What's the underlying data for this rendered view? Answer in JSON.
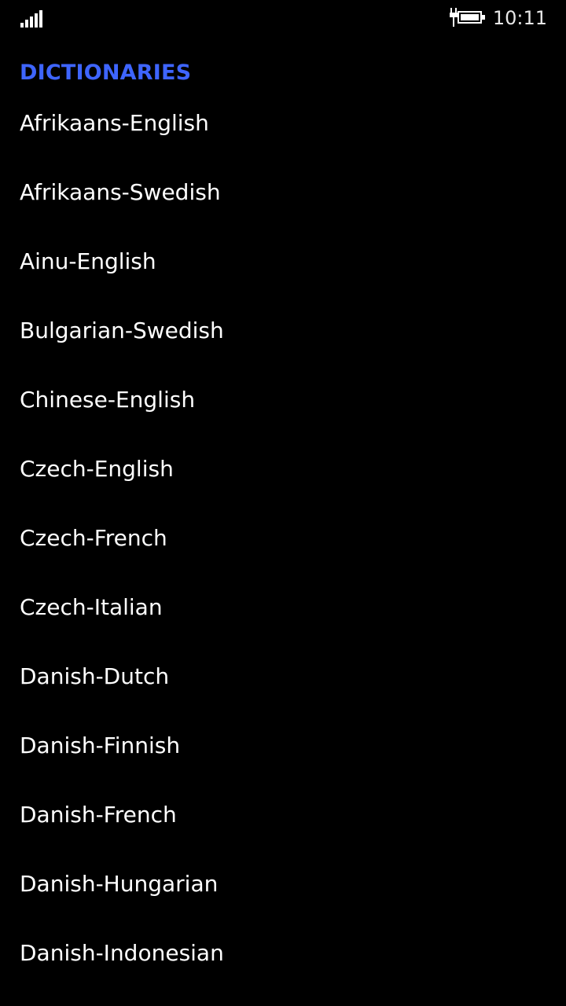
{
  "status_bar": {
    "signal_icon": "signal-strength-icon",
    "battery_icon": "battery-charging-icon",
    "time": "10:11"
  },
  "colors": {
    "background": "#000000",
    "accent": "#3e65ff",
    "text": "#ffffff"
  },
  "header": {
    "title": "DICTIONARIES"
  },
  "dictionaries": [
    {
      "label": "Afrikaans-English"
    },
    {
      "label": "Afrikaans-Swedish"
    },
    {
      "label": "Ainu-English"
    },
    {
      "label": "Bulgarian-Swedish"
    },
    {
      "label": "Chinese-English"
    },
    {
      "label": "Czech-English"
    },
    {
      "label": "Czech-French"
    },
    {
      "label": "Czech-Italian"
    },
    {
      "label": "Danish-Dutch"
    },
    {
      "label": "Danish-Finnish"
    },
    {
      "label": "Danish-French"
    },
    {
      "label": "Danish-Hungarian"
    },
    {
      "label": "Danish-Indonesian"
    }
  ]
}
